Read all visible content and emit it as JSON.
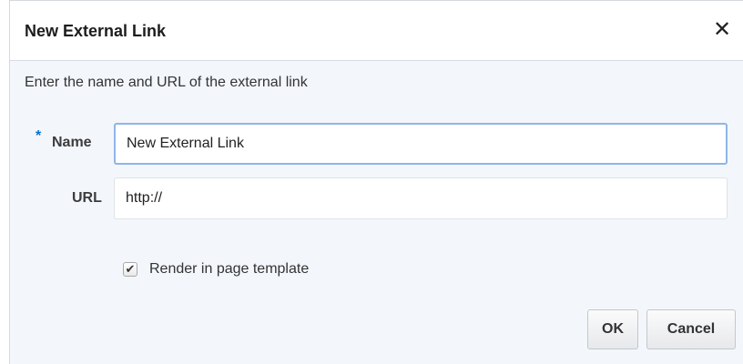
{
  "dialog": {
    "title": "New External Link",
    "close_icon": "✕",
    "instructions": "Enter the name and URL of the external link"
  },
  "form": {
    "required_marker": "*",
    "name_label": "Name",
    "name_value": "New External Link",
    "url_label": "URL",
    "url_value": "http://",
    "render_checkbox_checked": true,
    "render_checkbox_label": "Render in page template"
  },
  "buttons": {
    "ok_label": "OK",
    "cancel_label": "Cancel"
  },
  "colors": {
    "required_marker": "#0572ce",
    "focused_field_border": "#8eb6e8",
    "dialog_background": "#f3f6fb"
  }
}
